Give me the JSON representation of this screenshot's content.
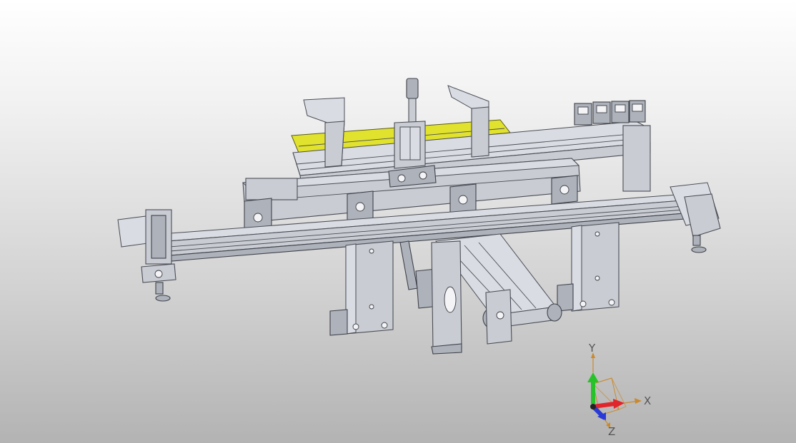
{
  "viewport": {
    "background_top": "#ffffff",
    "background_bottom": "#b3b3b3",
    "part_color": "#c9ccd3",
    "highlight_part_color": "#e1e22d",
    "edge_color": "#4a4d55"
  },
  "triad": {
    "x_label": "X",
    "y_label": "Y",
    "z_label": "Z",
    "x_color": "#e0262a",
    "y_color": "#27c22a",
    "z_color": "#2a3ad6",
    "label_arrow_color": "#c98a2e"
  }
}
